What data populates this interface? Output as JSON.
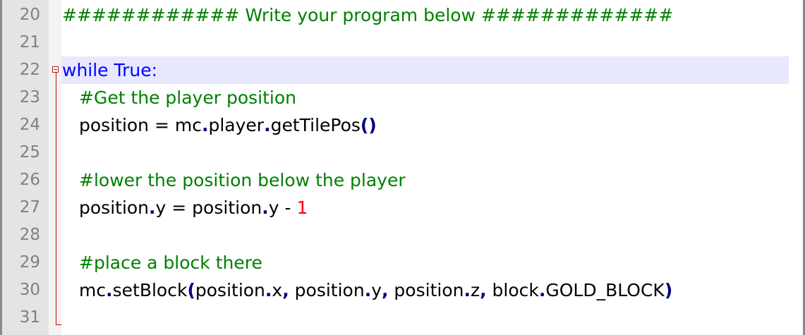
{
  "editor": {
    "lines": [
      {
        "num": "20",
        "tokens": [
          {
            "t": "############ Write your program below #############",
            "c": "comment"
          }
        ]
      },
      {
        "num": "21",
        "tokens": []
      },
      {
        "num": "22",
        "tokens": [
          {
            "t": "while",
            "c": "kw"
          },
          {
            "t": " ",
            "c": "txt"
          },
          {
            "t": "True",
            "c": "kw"
          },
          {
            "t": ":",
            "c": "kw"
          }
        ]
      },
      {
        "num": "23",
        "tokens": [
          {
            "t": "#Get the player position",
            "c": "comment"
          }
        ]
      },
      {
        "num": "24",
        "tokens": [
          {
            "t": "position ",
            "c": "txt"
          },
          {
            "t": "=",
            "c": "txt"
          },
          {
            "t": " mc",
            "c": "txt"
          },
          {
            "t": ".",
            "c": "op"
          },
          {
            "t": "player",
            "c": "txt"
          },
          {
            "t": ".",
            "c": "op"
          },
          {
            "t": "getTilePos",
            "c": "txt"
          },
          {
            "t": "()",
            "c": "op"
          }
        ]
      },
      {
        "num": "25",
        "tokens": []
      },
      {
        "num": "26",
        "tokens": [
          {
            "t": "#lower the position below the player",
            "c": "comment"
          }
        ]
      },
      {
        "num": "27",
        "tokens": [
          {
            "t": "position",
            "c": "txt"
          },
          {
            "t": ".",
            "c": "op"
          },
          {
            "t": "y ",
            "c": "txt"
          },
          {
            "t": "=",
            "c": "txt"
          },
          {
            "t": " position",
            "c": "txt"
          },
          {
            "t": ".",
            "c": "op"
          },
          {
            "t": "y ",
            "c": "txt"
          },
          {
            "t": "-",
            "c": "txt"
          },
          {
            "t": " ",
            "c": "txt"
          },
          {
            "t": "1",
            "c": "num"
          }
        ]
      },
      {
        "num": "28",
        "tokens": []
      },
      {
        "num": "29",
        "tokens": [
          {
            "t": "#place a block there",
            "c": "comment"
          }
        ]
      },
      {
        "num": "30",
        "tokens": [
          {
            "t": "mc",
            "c": "txt"
          },
          {
            "t": ".",
            "c": "op"
          },
          {
            "t": "setBlock",
            "c": "txt"
          },
          {
            "t": "(",
            "c": "op"
          },
          {
            "t": "position",
            "c": "txt"
          },
          {
            "t": ".",
            "c": "op"
          },
          {
            "t": "x",
            "c": "txt"
          },
          {
            "t": ",",
            "c": "op"
          },
          {
            "t": " position",
            "c": "txt"
          },
          {
            "t": ".",
            "c": "op"
          },
          {
            "t": "y",
            "c": "txt"
          },
          {
            "t": ",",
            "c": "op"
          },
          {
            "t": " position",
            "c": "txt"
          },
          {
            "t": ".",
            "c": "op"
          },
          {
            "t": "z",
            "c": "txt"
          },
          {
            "t": ",",
            "c": "op"
          },
          {
            "t": " block",
            "c": "txt"
          },
          {
            "t": ".",
            "c": "op"
          },
          {
            "t": "GOLD_BLOCK",
            "c": "txt"
          },
          {
            "t": ")",
            "c": "op"
          }
        ]
      },
      {
        "num": "31",
        "tokens": []
      }
    ],
    "current_line": "22",
    "fold_icon": "fold-minus-icon",
    "colors": {
      "comment": "#008000",
      "keyword": "#0000ff",
      "operator": "#000080",
      "number": "#ff0000",
      "current_line_bg": "#e8e8ff",
      "fold_marker": "#c01010"
    }
  }
}
